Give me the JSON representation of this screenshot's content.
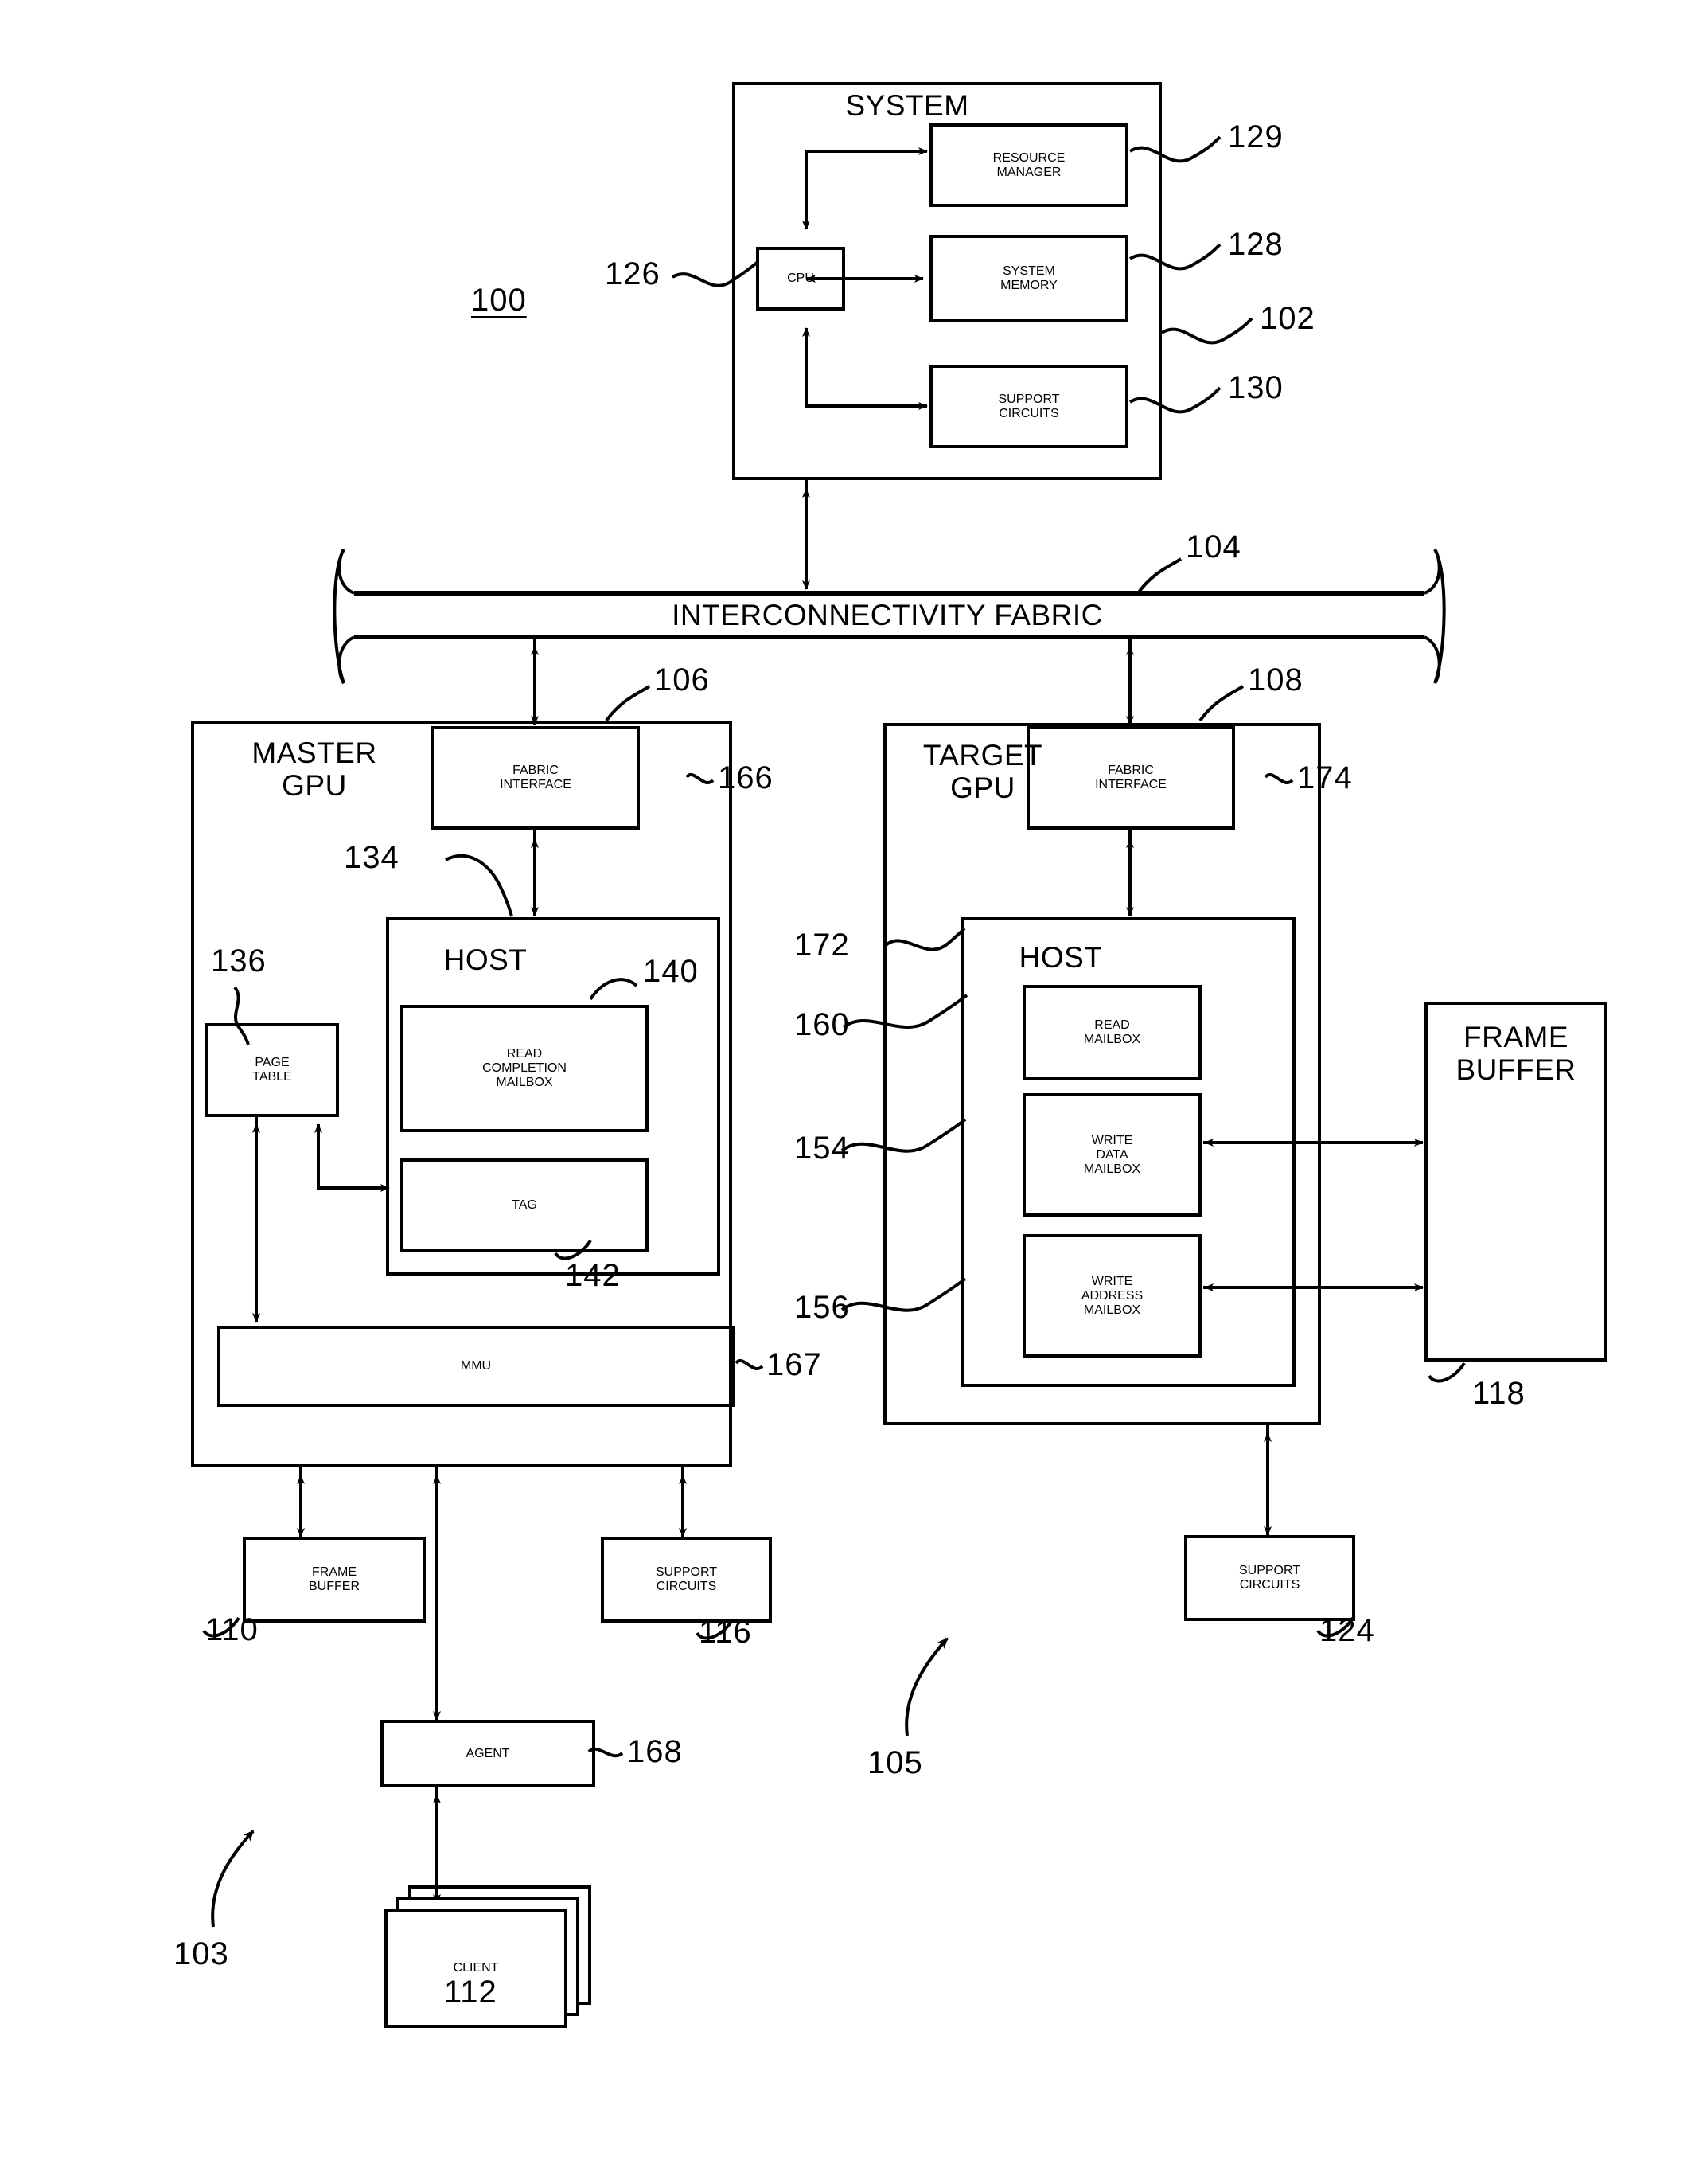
{
  "figure": {
    "top_level_ref": "100",
    "master_side_ref": "103",
    "target_side_ref": "105"
  },
  "system": {
    "title": "SYSTEM",
    "ref": "102",
    "cpu": {
      "label": "CPU",
      "ref": "126"
    },
    "resource_manager": {
      "label": "RESOURCE\nMANAGER",
      "ref": "129"
    },
    "system_memory": {
      "label": "SYSTEM\nMEMORY",
      "ref": "128"
    },
    "support_circuits": {
      "label": "SUPPORT\nCIRCUITS",
      "ref": "130"
    }
  },
  "fabric": {
    "label": "INTERCONNECTIVITY FABRIC",
    "ref": "104"
  },
  "master_gpu": {
    "title": "MASTER\nGPU",
    "ref": "106",
    "fabric_interface": {
      "label": "FABRIC\nINTERFACE",
      "ref": "166"
    },
    "host": {
      "label": "HOST",
      "ref": "134"
    },
    "read_completion_mailbox": {
      "label": "READ\nCOMPLETION\nMAILBOX",
      "ref": "140"
    },
    "tag": {
      "label": "TAG",
      "ref": "142"
    },
    "page_table": {
      "label": "PAGE\nTABLE",
      "ref": "136"
    },
    "mmu": {
      "label": "MMU",
      "ref": "167"
    },
    "frame_buffer": {
      "label": "FRAME\nBUFFER",
      "ref": "110"
    },
    "support_circuits": {
      "label": "SUPPORT\nCIRCUITS",
      "ref": "116"
    },
    "agent": {
      "label": "AGENT",
      "ref": "168"
    },
    "client": {
      "label": "CLIENT",
      "ref": "112"
    }
  },
  "target_gpu": {
    "title": "TARGET\nGPU",
    "ref": "108",
    "fabric_interface": {
      "label": "FABRIC\nINTERFACE",
      "ref": "174"
    },
    "host": {
      "label": "HOST",
      "ref": "172"
    },
    "read_mailbox": {
      "label": "READ\nMAILBOX",
      "ref": "160"
    },
    "write_data_mailbox": {
      "label": "WRITE\nDATA\nMAILBOX",
      "ref": "154"
    },
    "write_address_mailbox": {
      "label": "WRITE\nADDRESS\nMAILBOX",
      "ref": "156"
    },
    "frame_buffer": {
      "label": "FRAME\nBUFFER",
      "ref": "118"
    },
    "support_circuits": {
      "label": "SUPPORT\nCIRCUITS",
      "ref": "124"
    }
  }
}
